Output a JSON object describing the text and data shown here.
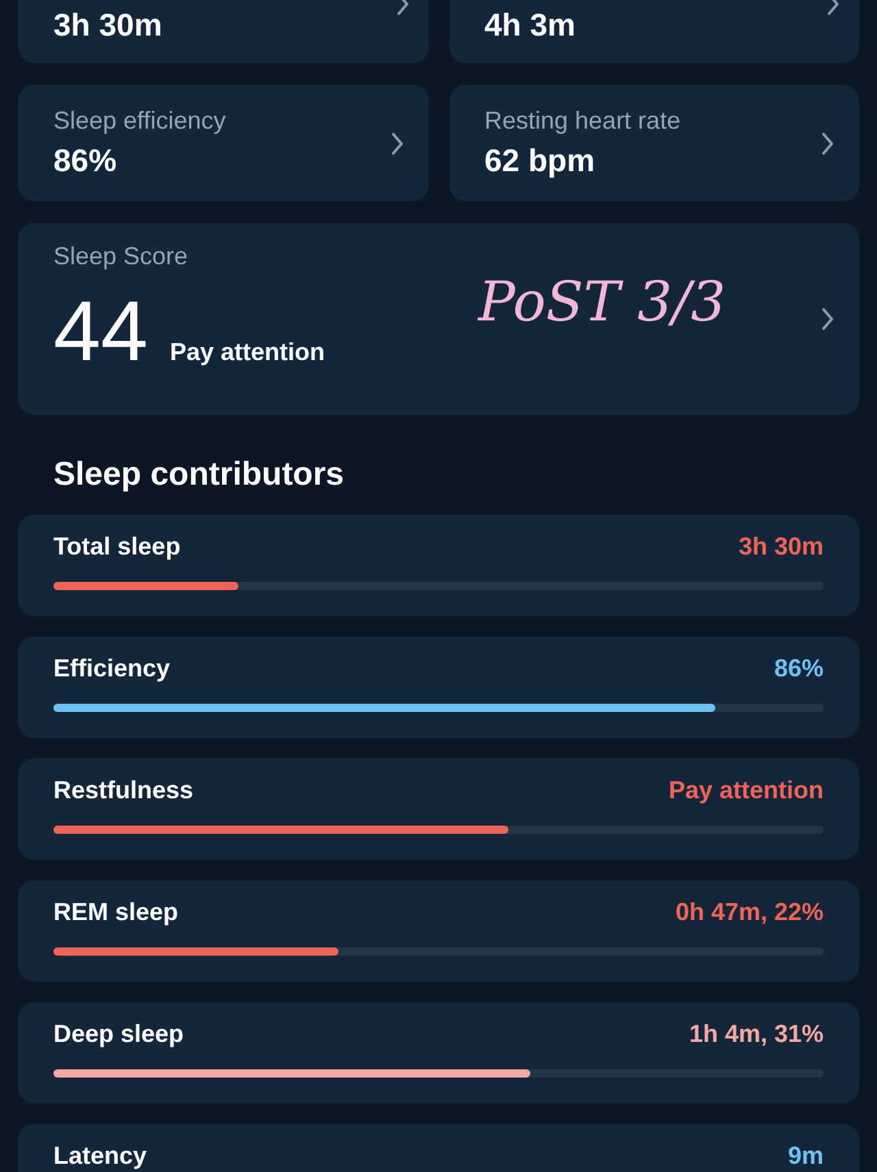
{
  "top_metrics": [
    {
      "value": "3h 30m"
    },
    {
      "value": "4h 3m"
    }
  ],
  "metrics": [
    {
      "label": "Sleep efficiency",
      "value": "86%"
    },
    {
      "label": "Resting heart rate",
      "value": "62 bpm"
    }
  ],
  "sleep_score": {
    "label": "Sleep Score",
    "score": "44",
    "status": "Pay attention",
    "annotation": "PoST 3/3"
  },
  "contributors_heading": "Sleep contributors",
  "contributors": [
    {
      "name": "Total sleep",
      "value": "3h 30m",
      "color": "#f06458",
      "level": 0.24
    },
    {
      "name": "Efficiency",
      "value": "86%",
      "color": "#6ec1f5",
      "level": 0.86
    },
    {
      "name": "Restfulness",
      "value": "Pay attention",
      "color": "#f06458",
      "level": 0.59
    },
    {
      "name": "REM sleep",
      "value": "0h 47m, 22%",
      "color": "#f06458",
      "level": 0.37
    },
    {
      "name": "Deep sleep",
      "value": "1h 4m, 31%",
      "color": "#f5a7a2",
      "level": 0.62
    },
    {
      "name": "Latency",
      "value": "9m",
      "color": "#6ec1f5"
    }
  ]
}
